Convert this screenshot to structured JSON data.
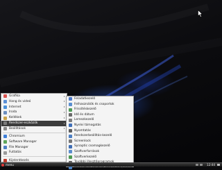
{
  "main_menu": {
    "items": [
      {
        "label": "Grafika",
        "color": "#d9534f",
        "submenu": true
      },
      {
        "label": "Hang és videó",
        "color": "#5b8fd6",
        "submenu": true
      },
      {
        "label": "Internet",
        "color": "#4a90d9",
        "submenu": true
      },
      {
        "label": "Iroda",
        "color": "#6c8ebf",
        "submenu": true
      },
      {
        "label": "Kellékek",
        "color": "#c9a24a",
        "submenu": true
      },
      {
        "label": "Rendszer-eszközök",
        "color": "#7a7a7a",
        "submenu": true,
        "selected": true
      },
      {
        "label": "Beállítások",
        "color": "#8a8a8a",
        "submenu": true
      }
    ],
    "items2": [
      {
        "label": "Chromium",
        "color": "#3f7fd8"
      },
      {
        "label": "Software Manager",
        "color": "#5fa55a"
      },
      {
        "label": "File Manager",
        "color": "#4d7fc4"
      },
      {
        "label": "Futtatás",
        "color": "#9a9a9a"
      }
    ],
    "items3": [
      {
        "label": "Kijelentkezés",
        "color": "#c0392b"
      }
    ]
  },
  "sub_menu": {
    "items": [
      {
        "label": "Feladatkezelő",
        "color": "#4d79c7"
      },
      {
        "label": "Felhasználók és csoportok",
        "color": "#5a8fd0"
      },
      {
        "label": "Frissítéskezelő",
        "color": "#4f9a57"
      },
      {
        "label": "Idő és dátum",
        "color": "#6b6b6b"
      },
      {
        "label": "Lemezkezelő",
        "color": "#7d7d7d"
      },
      {
        "label": "Nyelvi támogatás",
        "color": "#3f6fb8"
      },
      {
        "label": "Nyomtatás",
        "color": "#5c5c5c"
      },
      {
        "label": "Rendszerbeállítás-kezelő",
        "color": "#4b7ec2"
      },
      {
        "label": "Screenlock",
        "color": "#777777"
      },
      {
        "label": "Synaptic csomagkezelő",
        "color": "#3e6db4"
      },
      {
        "label": "Szoftverforrások",
        "color": "#5b8dcc"
      },
      {
        "label": "Szoftverkezelő",
        "color": "#4d9a52"
      },
      {
        "label": "További illesztőprogramok",
        "color": "#5a5a5a"
      },
      {
        "label": "Windowsos vezeték nélküli meghajtók",
        "color": "#4a7fc0"
      }
    ]
  },
  "taskbar": {
    "start_label": "menu",
    "clock": "12:44"
  }
}
